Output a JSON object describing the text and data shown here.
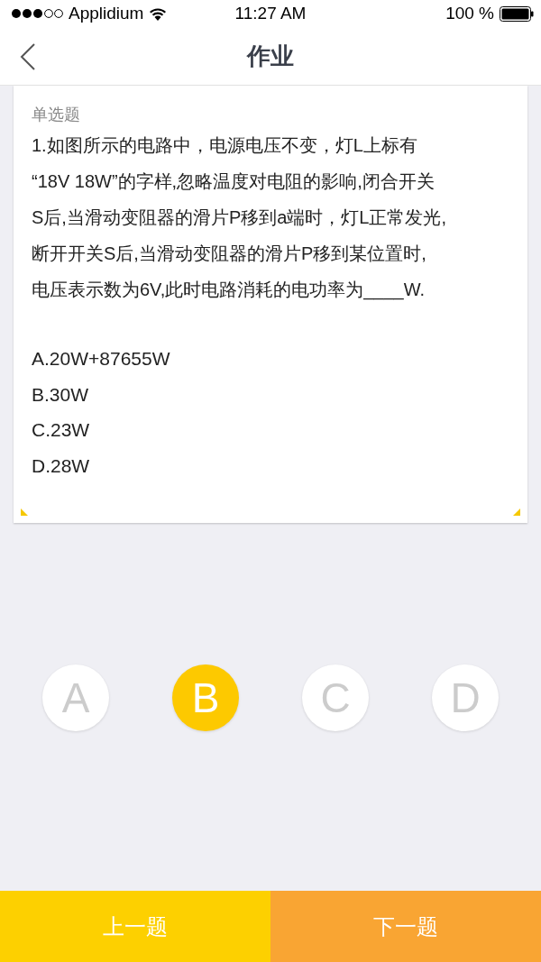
{
  "status_bar": {
    "carrier": "Applidium",
    "time": "11:27 AM",
    "battery": "100 %"
  },
  "nav": {
    "title": "作业"
  },
  "question": {
    "type_label": "单选题",
    "lines": [
      "1.如图所示的电路中，电源电压不变，灯L上标有",
      "“18V 18W”的字样,忽略温度对电阻的影响,闭合开关",
      "S后,当滑动变阻器的滑片P移到a端时，灯L正常发光,",
      "断开开关S后,当滑动变阻器的滑片P移到某位置时,",
      "电压表示数为6V,此时电路消耗的电功率为____W."
    ],
    "options": [
      "A.20W+87655W",
      "B.30W",
      "C.23W",
      "D.28W"
    ]
  },
  "answers": [
    {
      "label": "A",
      "selected": false
    },
    {
      "label": "B",
      "selected": true
    },
    {
      "label": "C",
      "selected": false
    },
    {
      "label": "D",
      "selected": false
    }
  ],
  "footer": {
    "prev": "上一题",
    "next": "下一题"
  }
}
